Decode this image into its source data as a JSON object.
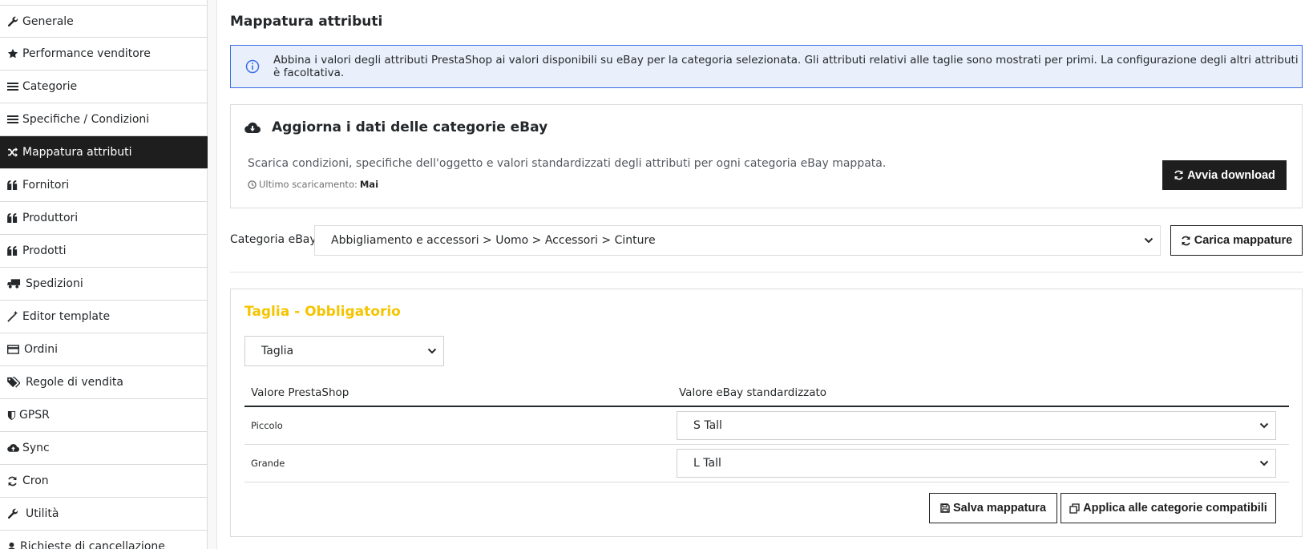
{
  "sidebar": {
    "items": [
      {
        "label": "Generale",
        "icon": "wrench-icon",
        "active": false
      },
      {
        "label": "Performance venditore",
        "icon": "star-icon",
        "active": false
      },
      {
        "label": "Categorie",
        "icon": "list-icon",
        "active": false
      },
      {
        "label": "Specifiche / Condizioni",
        "icon": "list-icon",
        "active": false
      },
      {
        "label": "Mappatura attributi",
        "icon": "shuffle-icon",
        "active": true
      },
      {
        "label": "Fornitori",
        "icon": "quote-icon",
        "active": false
      },
      {
        "label": "Produttori",
        "icon": "quote-icon",
        "active": false
      },
      {
        "label": "Prodotti",
        "icon": "quote-icon",
        "active": false
      },
      {
        "label": "Spedizioni",
        "icon": "truck-icon",
        "active": false
      },
      {
        "label": "Editor template",
        "icon": "magic-wand-icon",
        "active": false
      },
      {
        "label": "Ordini",
        "icon": "credit-card-icon",
        "active": false
      },
      {
        "label": "Regole di vendita",
        "icon": "tags-icon",
        "active": false
      },
      {
        "label": "GPSR",
        "icon": "shield-icon",
        "active": false
      },
      {
        "label": "Sync",
        "icon": "cloud-upload-icon",
        "active": false
      },
      {
        "label": "Cron",
        "icon": "refresh-icon",
        "active": false
      },
      {
        "label": "Utilità",
        "icon": "wrench-icon",
        "active": false
      },
      {
        "label": "Richieste di cancellazione",
        "icon": "user-icon",
        "active": false
      }
    ]
  },
  "main": {
    "title": "Mappatura attributi",
    "alert": "Abbina i valori degli attributi PrestaShop ai valori disponibili su eBay per la categoria selezionata. Gli attributi relativi alle taglie sono mostrati per primi. La configurazione degli altri attributi è facoltativa.",
    "download_card": {
      "title": "Aggiorna i dati delle categorie eBay",
      "description": "Scarica condizioni, specifiche dell'oggetto e valori standardizzati degli attributi per ogni categoria eBay mappata.",
      "last_label": "Ultimo scaricamento:",
      "last_value": "Mai",
      "button": "Avvia download"
    },
    "category": {
      "label": "Categoria eBay",
      "selected": "Abbigliamento e accessori > Uomo > Accessori > Cinture",
      "button": "Carica mappature"
    },
    "panel": {
      "title": "Taglia - Obbligatorio",
      "attribute_selected": "Taglia",
      "col_prestashop": "Valore PrestaShop",
      "col_ebay": "Valore eBay standardizzato",
      "rows": [
        {
          "prestashop": "Piccolo",
          "ebay": "S Tall"
        },
        {
          "prestashop": "Grande",
          "ebay": "L Tall"
        }
      ],
      "save_button": "Salva mappatura",
      "apply_button": "Applica alle categorie compatibili"
    }
  },
  "colors": {
    "dark": "#1e1e1e",
    "alert_bg": "#eaf0fb",
    "alert_border": "#3d6ee8",
    "required_title": "#f5c400"
  }
}
